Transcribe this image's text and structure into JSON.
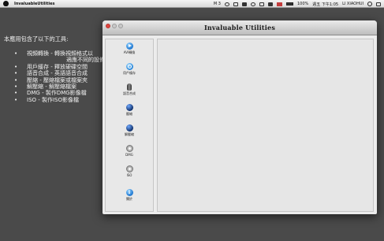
{
  "menubar": {
    "app_name": "InvaluableUtilities",
    "extra_label": "M 3",
    "battery_text": "100%",
    "clock": "週五 下午1:05",
    "user": "LI XIAOHUI"
  },
  "intro": {
    "heading": "本應用包含了以下的工具:",
    "features": [
      {
        "line1": "視頻轉換 - 轉換視頻格式以",
        "line2": "適應不同的設備"
      },
      {
        "line1": "用戶緩存 - 釋放硬碟空間"
      },
      {
        "line1": "語音合成 - 英語語音合成"
      },
      {
        "line1": "壓縮 - 壓縮檔案或檔案夾"
      },
      {
        "line1": "解壓縮 - 解壓縮檔案"
      },
      {
        "line1": "DMG - 製作DMG影像檔"
      },
      {
        "line1": "ISO - 製作ISO影像檔"
      }
    ]
  },
  "window": {
    "title": "Invaluable Utilities",
    "tools": [
      {
        "label": "AVI轉換",
        "icon": "video-convert-icon"
      },
      {
        "label": "用戶緩存",
        "icon": "user-cache-icon"
      },
      {
        "label": "語音合成",
        "icon": "microphone-icon"
      },
      {
        "label": "壓縮",
        "icon": "compress-icon"
      },
      {
        "label": "解壓縮",
        "icon": "decompress-icon"
      },
      {
        "label": "DMG",
        "icon": "dmg-disc-icon"
      },
      {
        "label": "ISO",
        "icon": "iso-disc-icon"
      },
      {
        "label": "關於",
        "icon": "info-icon"
      }
    ]
  }
}
